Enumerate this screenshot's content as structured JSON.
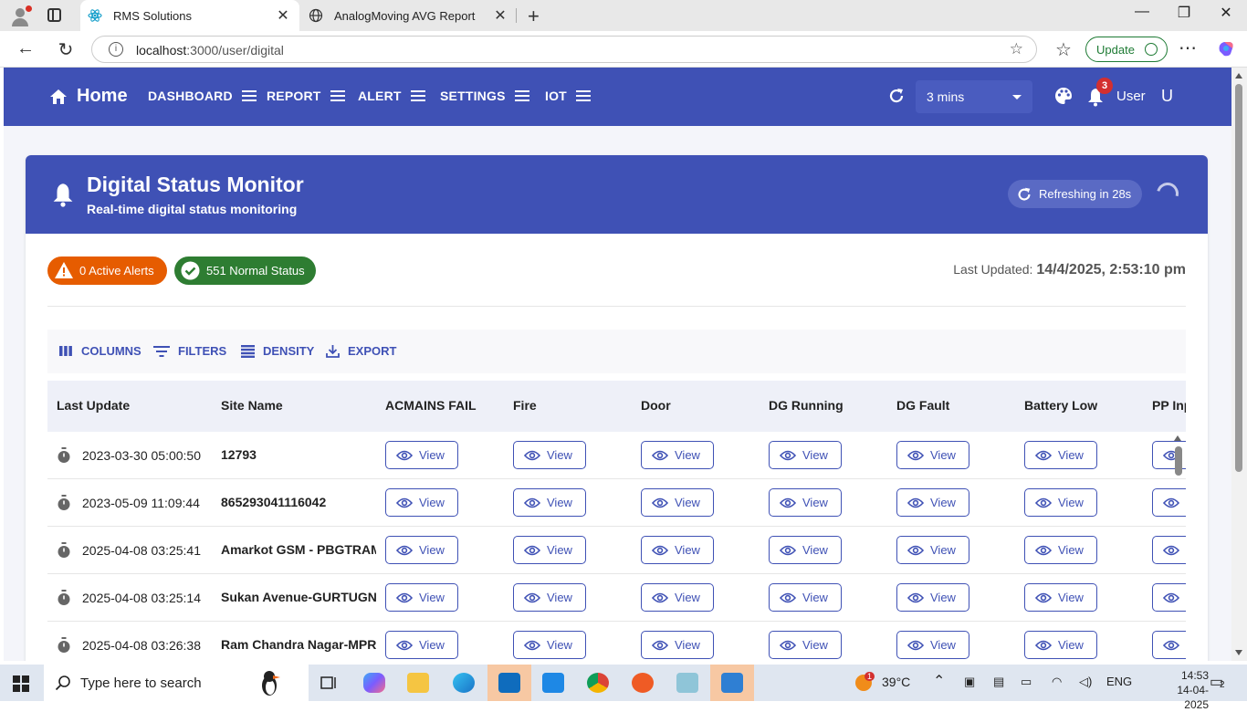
{
  "browser": {
    "tabs": [
      {
        "title": "RMS Solutions",
        "active": true
      },
      {
        "title": "AnalogMoving AVG Report",
        "active": false
      }
    ],
    "url_host": "localhost",
    "url_path": ":3000/user/digital",
    "update_label": "Update"
  },
  "appbar": {
    "home_label": "Home",
    "menu": [
      "DASHBOARD",
      "REPORT",
      "ALERT",
      "SETTINGS",
      "IOT"
    ],
    "interval": "3 mins",
    "notification_count": "3",
    "user_label": "User",
    "avatar_letter": "U",
    "color": "#3f51b5"
  },
  "monitor": {
    "title": "Digital Status Monitor",
    "subtitle": "Real-time digital status monitoring",
    "refresh_text": "Refreshing in 28s",
    "active_alerts": "0 Active Alerts",
    "normal_status": "551 Normal Status",
    "last_updated_label": "Last Updated: ",
    "last_updated_value": "14/4/2025, 2:53:10 pm",
    "alert_color": "#e65c00",
    "normal_color": "#2e7d32"
  },
  "toolbar": {
    "columns": "COLUMNS",
    "filters": "FILTERS",
    "density": "DENSITY",
    "export": "EXPORT"
  },
  "grid": {
    "columns": [
      "Last Update",
      "Site Name",
      "ACMAINS FAIL",
      "Fire",
      "Door",
      "DG Running",
      "DG Fault",
      "Battery Low",
      "PP Inp"
    ],
    "view_label": "View",
    "rows": [
      {
        "time": "2023-03-30 05:00:50",
        "site": "12793"
      },
      {
        "time": "2023-05-09 11:09:44",
        "site": "865293041116042"
      },
      {
        "time": "2025-04-08 03:25:41",
        "site": "Amarkot GSM - PBGTRAMR"
      },
      {
        "time": "2025-04-08 03:25:14",
        "site": "Sukan Avenue-GURTUGNDG"
      },
      {
        "time": "2025-04-08 03:26:38",
        "site": "Ram Chandra Nagar-MPRP"
      }
    ]
  },
  "taskbar": {
    "search_placeholder": "Type here to search",
    "weather": "39°C",
    "weather_badge": "1",
    "language": "ENG",
    "time": "14:53",
    "date": "14-04-2025",
    "notifications": "2"
  }
}
